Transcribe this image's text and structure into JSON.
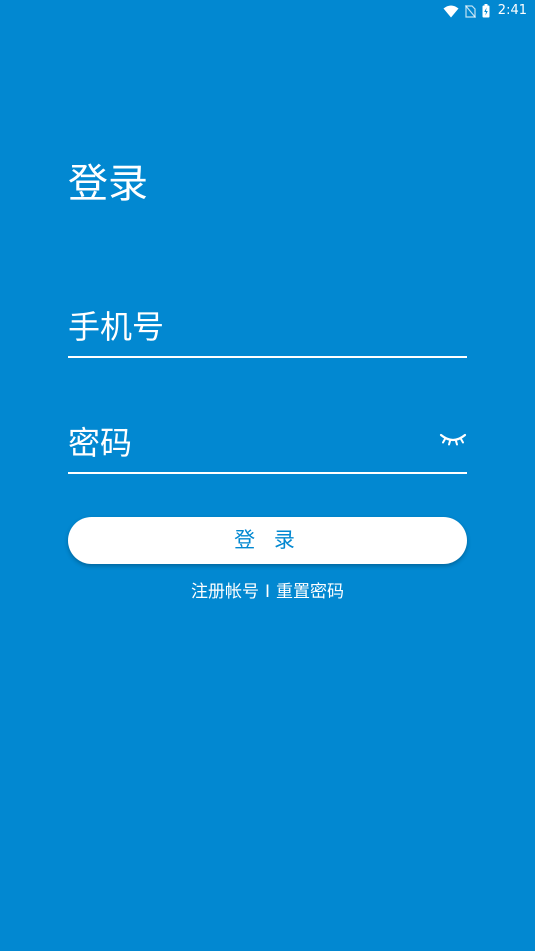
{
  "status_bar": {
    "time": "2:41",
    "icons": [
      "wifi-icon",
      "no-sim-icon",
      "battery-charging-icon"
    ]
  },
  "login": {
    "title": "登录",
    "phone_placeholder": "手机号",
    "password_placeholder": "密码",
    "password_toggle_icon": "eye-closed-icon",
    "submit_label": "登 录",
    "register_link": "注册帐号",
    "separator": "I",
    "reset_link": "重置密码"
  },
  "colors": {
    "background": "#0288D1",
    "text": "#FFFFFF",
    "button_text": "#0288D1",
    "button_background": "#FFFFFF"
  }
}
